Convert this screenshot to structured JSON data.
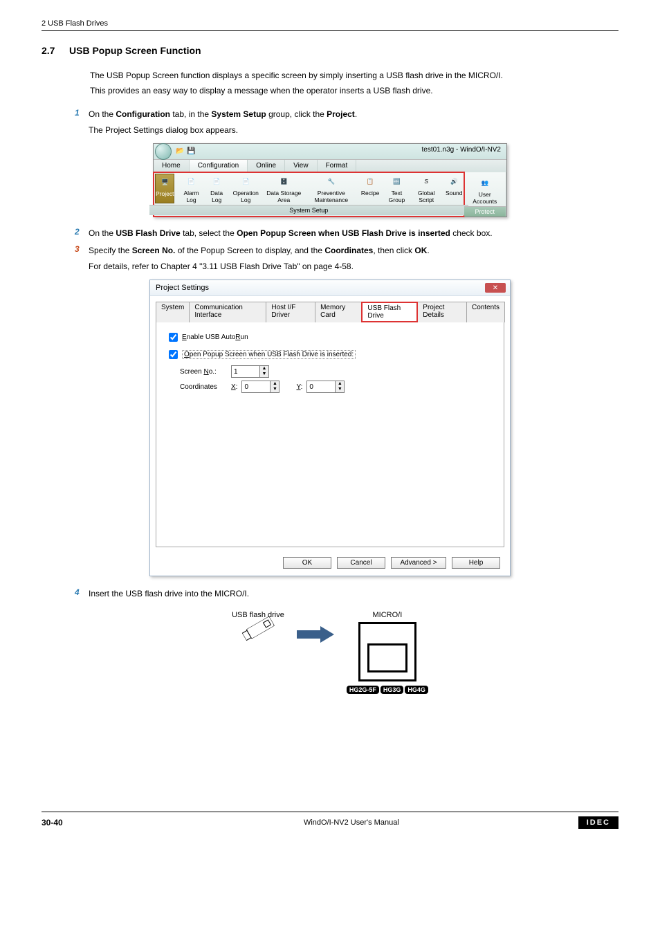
{
  "header": {
    "text": "2 USB Flash Drives"
  },
  "section": {
    "number": "2.7",
    "title": "USB Popup Screen Function"
  },
  "intro": {
    "line1": "The USB Popup Screen function displays a specific screen by simply inserting a USB flash drive in the MICRO/I.",
    "line2": "This provides an easy way to display a message when the operator inserts a USB flash drive."
  },
  "steps": {
    "s1": {
      "num": "1",
      "pre": "On the ",
      "b1": "Configuration",
      "mid1": " tab, in the ",
      "b2": "System Setup",
      "mid2": " group, click the ",
      "b3": "Project",
      "post": "."
    },
    "s1sub": "The Project Settings dialog box appears.",
    "s2": {
      "num": "2",
      "pre": "On the ",
      "b1": "USB Flash Drive",
      "mid1": " tab, select the ",
      "b2": "Open Popup Screen when USB Flash Drive is inserted",
      "post": " check box."
    },
    "s3": {
      "num": "3",
      "pre": "Specify the ",
      "b1": "Screen No.",
      "mid1": " of the Popup Screen to display, and the ",
      "b2": "Coordinates",
      "mid2": ", then click ",
      "b3": "OK",
      "post": "."
    },
    "s3sub": "For details, refer to Chapter 4 \"3.11 USB Flash Drive Tab\" on page 4-58.",
    "s4": {
      "num": "4",
      "text": "Insert the USB flash drive into the MICRO/I."
    }
  },
  "ribbon": {
    "filename": "test01.n3g - WindO/I-NV2",
    "tabs": [
      "Home",
      "Configuration",
      "Online",
      "View",
      "Format"
    ],
    "project": "Project",
    "icons": {
      "alarm": "Alarm Log",
      "data": "Data Log",
      "oper": "Operation Log",
      "storage": "Data Storage Area",
      "prev": "Preventive Maintenance",
      "recipe": "Recipe",
      "tgroup": "Text Group",
      "gscript": "Global Script",
      "sound": "Sound",
      "user": "User Accounts"
    },
    "grouplabel": "System Setup",
    "protect": "Protect"
  },
  "dialog": {
    "title": "Project Settings",
    "tabs": {
      "system": "System",
      "comm": "Communication Interface",
      "host": "Host I/F Driver",
      "mem": "Memory Card",
      "usb": "USB Flash Drive",
      "proj": "Project Details",
      "cont": "Contents"
    },
    "chk1": "Enable USB AutoRun",
    "chk2": "Open Popup Screen when USB Flash Drive is inserted:",
    "screenNoLabel": "Screen No.:",
    "screenNoVal": "1",
    "coordLabel": "Coordinates",
    "xLabel": "X:",
    "xVal": "0",
    "yLabel": "Y:",
    "yVal": "0",
    "btns": {
      "ok": "OK",
      "cancel": "Cancel",
      "adv": "Advanced >",
      "help": "Help"
    }
  },
  "diagram": {
    "usbLabel": "USB flash drive",
    "microLabel": "MICRO/I",
    "badges": [
      "HG2G-5F",
      "HG3G",
      "HG4G"
    ]
  },
  "footer": {
    "page": "30-40",
    "center": "WindO/I-NV2 User's Manual",
    "brand": "IDEC"
  }
}
